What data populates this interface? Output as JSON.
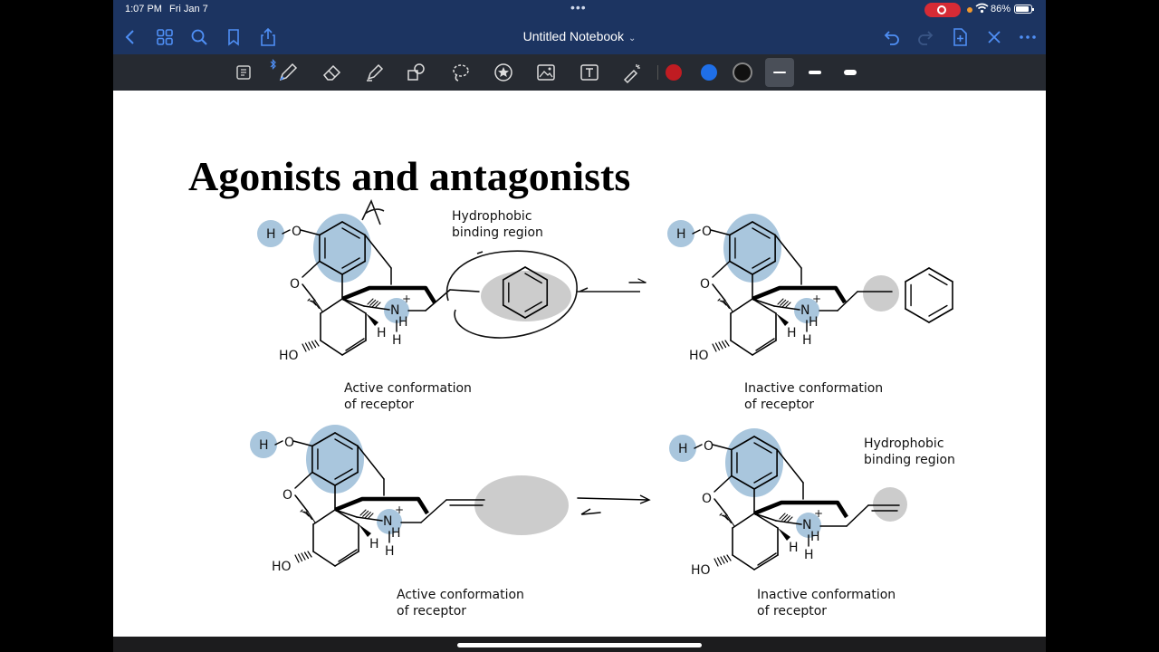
{
  "status_bar": {
    "time": "1:07 PM",
    "date": "Fri Jan 7",
    "battery": "86%"
  },
  "nav": {
    "title": "Untitled Notebook"
  },
  "colors": {
    "red": "#c01c22",
    "blue": "#1f6fe8",
    "black": "#111111",
    "accent": "#4f8ff5",
    "site_blue": "#a9c6dd",
    "grey_region": "#cccccc"
  },
  "icons": [
    "back-icon",
    "grid-icon",
    "search-icon",
    "bookmark-icon",
    "share-icon",
    "undo-icon",
    "redo-icon",
    "add-page-icon",
    "close-icon",
    "more-icon",
    "reader-icon",
    "bluetooth-icon",
    "pen-icon",
    "eraser-icon",
    "highlighter-icon",
    "shapes-icon",
    "lasso-icon",
    "sticker-icon",
    "image-icon",
    "text-icon",
    "laser-icon"
  ],
  "slide": {
    "title": "Agonists and antagonists",
    "hydrophobic_top": [
      "Hydrophobic",
      "binding region"
    ],
    "hydrophobic_bottom": [
      "Hydrophobic",
      "binding region"
    ],
    "captions": {
      "tl": [
        "Active conformation",
        "of receptor"
      ],
      "tr": [
        "Inactive conformation",
        "of receptor"
      ],
      "bl": [
        "Active conformation",
        "of receptor"
      ],
      "br": [
        "Inactive conformation",
        "of receptor"
      ]
    },
    "atoms": {
      "H": "H",
      "O": "O",
      "N": "N",
      "plus": "+",
      "HO": "HO"
    }
  }
}
